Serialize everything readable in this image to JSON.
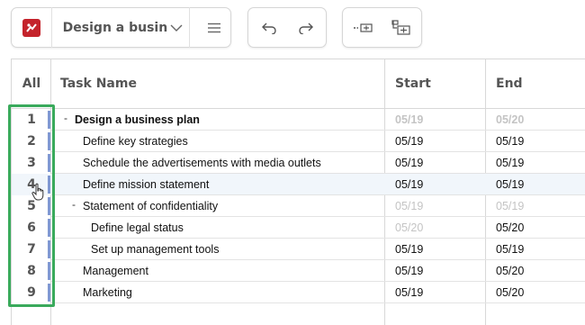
{
  "toolbar": {
    "app_icon": "project-app-icon",
    "project_title": "Design a busin…",
    "dropdown_icon": "chevron-down-icon",
    "menu_icon": "hamburger-menu-icon",
    "undo_icon": "undo-icon",
    "redo_icon": "redo-icon",
    "outdent_icon": "outdent-icon",
    "indent_icon": "indent-icon"
  },
  "grid": {
    "headers": {
      "all": "All",
      "task_name": "Task Name",
      "start": "Start",
      "end": "End"
    },
    "rows": [
      {
        "num": "1",
        "name": "Design a business plan",
        "collapse": "-",
        "start": "05/19",
        "end": "05/20"
      },
      {
        "num": "2",
        "name": "Define key strategies",
        "collapse": "",
        "start": "05/19",
        "end": "05/19"
      },
      {
        "num": "3",
        "name": "Schedule the advertisements with media outlets",
        "collapse": "",
        "start": "05/19",
        "end": "05/19"
      },
      {
        "num": "4",
        "name": "Define mission statement",
        "collapse": "",
        "start": "05/19",
        "end": "05/19"
      },
      {
        "num": "5",
        "name": "Statement of confidentiality",
        "collapse": "-",
        "start": "05/19",
        "end": "05/19"
      },
      {
        "num": "6",
        "name": "Define legal status",
        "collapse": "",
        "start": "05/20",
        "end": "05/20"
      },
      {
        "num": "7",
        "name": "Set up management tools",
        "collapse": "",
        "start": "05/19",
        "end": "05/19"
      },
      {
        "num": "8",
        "name": "Management",
        "collapse": "",
        "start": "05/19",
        "end": "05/20"
      },
      {
        "num": "9",
        "name": "Marketing",
        "collapse": "",
        "start": "05/19",
        "end": "05/20"
      }
    ]
  },
  "colors": {
    "selection": "#3aaa5c",
    "row_marker": "#8098d2",
    "app_brand": "#c4232b",
    "muted_date": "#c4c4c4"
  }
}
